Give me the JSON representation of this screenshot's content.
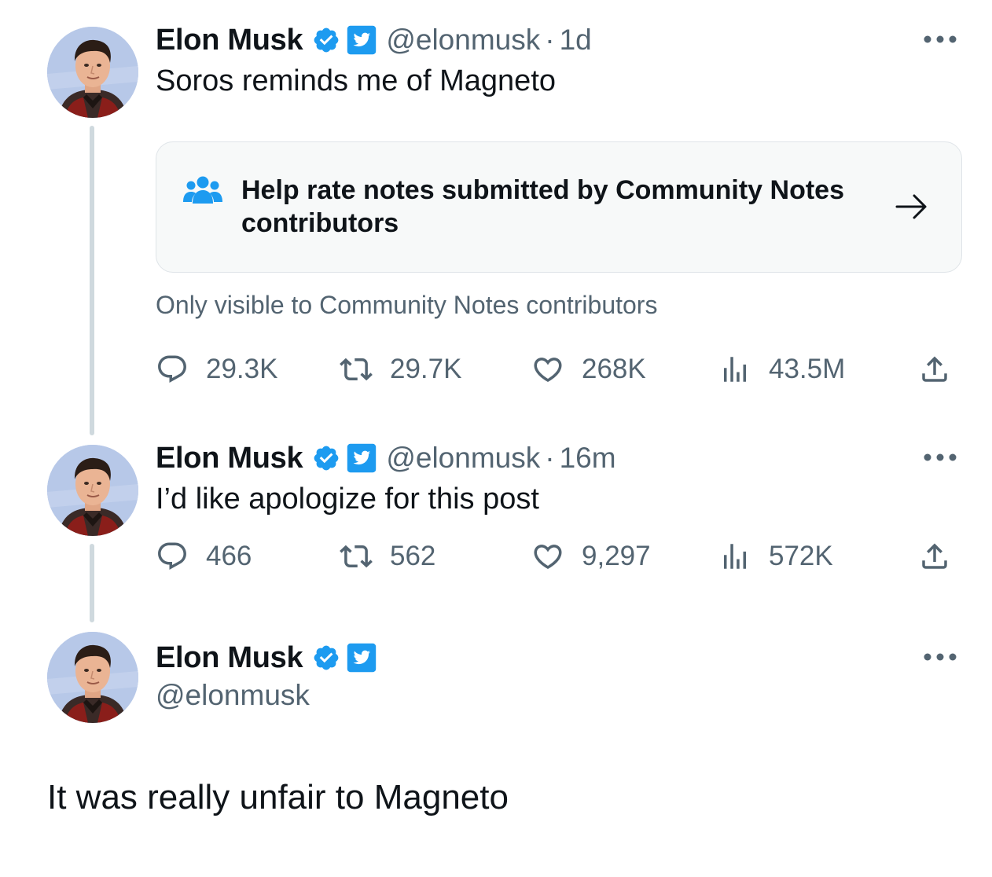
{
  "colors": {
    "accent": "#1d9bf0",
    "text_primary": "#0f1419",
    "text_secondary": "#536471",
    "thread_line": "#cfd9de",
    "card_bg": "#f7f9f9"
  },
  "tweets": [
    {
      "author": {
        "name": "Elon Musk",
        "handle": "@elonmusk",
        "avatar_icon": "avatar-photo",
        "badges": [
          "verified-badge-icon",
          "twitter-bird-badge-icon"
        ]
      },
      "separator": "·",
      "time": "1d",
      "text": "Soros reminds me of Magneto",
      "community_notes": {
        "icon": "community-people-icon",
        "prompt": "Help rate notes submitted by Community Notes contributors",
        "arrow_icon": "arrow-right-icon",
        "visibility": "Only visible to Community Notes contributors"
      },
      "stats": {
        "replies": "29.3K",
        "retweets": "29.7K",
        "likes": "268K",
        "views": "43.5M"
      }
    },
    {
      "author": {
        "name": "Elon Musk",
        "handle": "@elonmusk",
        "avatar_icon": "avatar-photo",
        "badges": [
          "verified-badge-icon",
          "twitter-bird-badge-icon"
        ]
      },
      "separator": "·",
      "time": "16m",
      "text": "I’d like apologize for this post",
      "stats": {
        "replies": "466",
        "retweets": "562",
        "likes": "9,297",
        "views": "572K"
      }
    },
    {
      "author": {
        "name": "Elon Musk",
        "handle": "@elonmusk",
        "avatar_icon": "avatar-photo",
        "badges": [
          "verified-badge-icon",
          "twitter-bird-badge-icon"
        ]
      },
      "text": "It was really unfair to Magneto"
    }
  ]
}
